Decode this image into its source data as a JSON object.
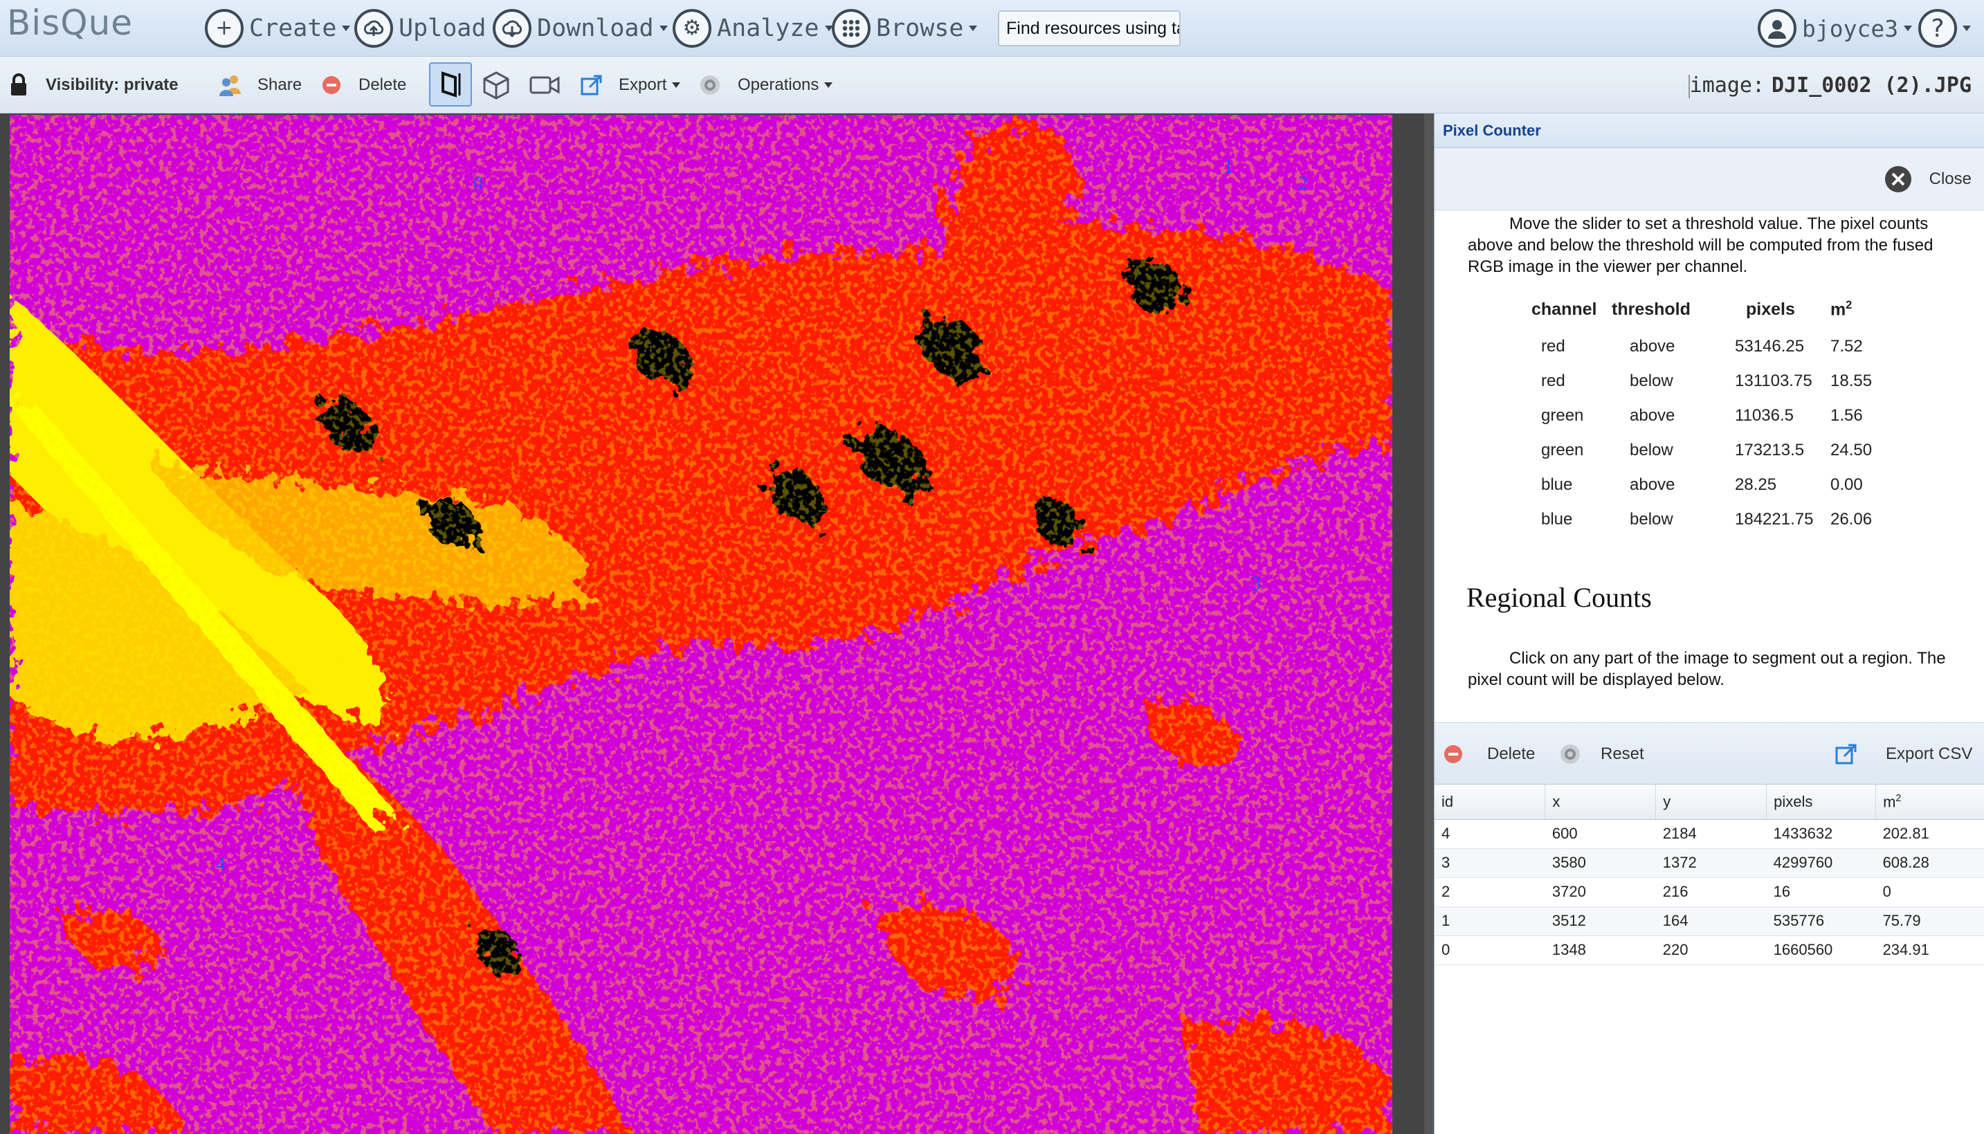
{
  "app": {
    "logo": "BisQue",
    "nav": {
      "create": "Create",
      "upload": "Upload",
      "download": "Download",
      "analyze": "Analyze",
      "browse": "Browse"
    },
    "search_placeholder": "Find resources using ta",
    "user": "bjoyce3",
    "help": "?"
  },
  "toolbar": {
    "visibility": "Visibility: private",
    "share": "Share",
    "delete": "Delete",
    "export": "Export",
    "operations": "Operations",
    "image_prefix": "image:",
    "image_name": "DJI_0002 (2).JPG"
  },
  "viewer": {
    "point_labels": [
      "0",
      "1",
      "2",
      "3",
      "4"
    ],
    "colors": {
      "background": "#d100d9",
      "high": "#ff0000",
      "peak": "#ffff00",
      "dark": "#000000"
    }
  },
  "panel": {
    "title": "Pixel Counter",
    "close": "Close",
    "description": "Move the slider to set a threshold value. The pixel counts above and below the threshold will be computed from the fused RGB image in the viewer per channel.",
    "threshold_headers": {
      "channel": "channel",
      "threshold": "threshold",
      "pixels": "pixels",
      "area": "m"
    },
    "threshold_rows": [
      [
        "red",
        "above",
        "53146.25",
        "7.52"
      ],
      [
        "red",
        "below",
        "131103.75",
        "18.55"
      ],
      [
        "green",
        "above",
        "11036.5",
        "1.56"
      ],
      [
        "green",
        "below",
        "173213.5",
        "24.50"
      ],
      [
        "blue",
        "above",
        "28.25",
        "0.00"
      ],
      [
        "blue",
        "below",
        "184221.75",
        "26.06"
      ]
    ],
    "regional_title": "Regional Counts",
    "regional_description": "Click on any part of the image to segment out a region. The pixel count will be displayed below.",
    "regional_toolbar": {
      "delete": "Delete",
      "reset": "Reset",
      "export_csv": "Export CSV"
    },
    "grid_headers": {
      "id": "id",
      "x": "x",
      "y": "y",
      "pixels": "pixels",
      "area": "m"
    },
    "grid_rows": [
      [
        "4",
        "600",
        "2184",
        "1433632",
        "202.81"
      ],
      [
        "3",
        "3580",
        "1372",
        "4299760",
        "608.28"
      ],
      [
        "2",
        "3720",
        "216",
        "16",
        "0"
      ],
      [
        "1",
        "3512",
        "164",
        "535776",
        "75.79"
      ],
      [
        "0",
        "1348",
        "220",
        "1660560",
        "234.91"
      ]
    ]
  }
}
